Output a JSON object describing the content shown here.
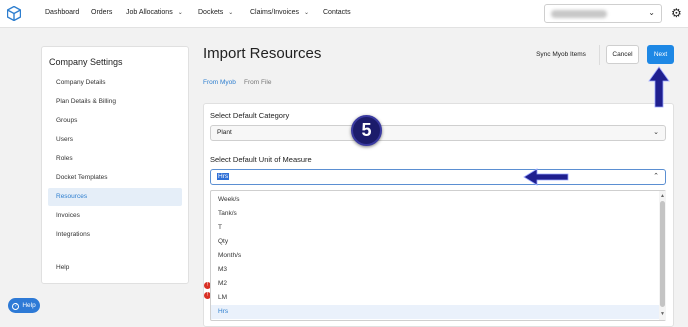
{
  "topbar": {
    "nav": [
      {
        "label": "Dashboard",
        "has_dropdown": false
      },
      {
        "label": "Orders",
        "has_dropdown": false
      },
      {
        "label": "Job Allocations",
        "has_dropdown": true
      },
      {
        "label": "Dockets",
        "has_dropdown": true
      },
      {
        "label": "Claims/Invoices",
        "has_dropdown": true
      },
      {
        "label": "Contacts",
        "has_dropdown": false
      }
    ],
    "user_select_icon": "chevron-down-icon",
    "settings_icon": "gear-icon"
  },
  "sidebar": {
    "title": "Company Settings",
    "items": [
      {
        "label": "Company Details"
      },
      {
        "label": "Plan Details & Billing"
      },
      {
        "label": "Groups"
      },
      {
        "label": "Users"
      },
      {
        "label": "Roles"
      },
      {
        "label": "Docket Templates"
      },
      {
        "label": "Resources",
        "active": true
      },
      {
        "label": "Invoices"
      },
      {
        "label": "Integrations"
      },
      {
        "label": "Help"
      }
    ]
  },
  "main": {
    "title": "Import Resources",
    "sync_label": "Sync Myob Items",
    "cancel_label": "Cancel",
    "next_label": "Next",
    "tabs": [
      {
        "label": "From Myob",
        "active": true
      },
      {
        "label": "From File",
        "active": false
      }
    ],
    "category_label": "Select Default Category",
    "category_value": "Plant",
    "uom_label": "Select Default Unit of Measure",
    "uom_value": "Hrs",
    "uom_options": [
      {
        "label": "Week/s"
      },
      {
        "label": "Tank/s"
      },
      {
        "label": "T"
      },
      {
        "label": "Qty"
      },
      {
        "label": "Month/s"
      },
      {
        "label": "M3"
      },
      {
        "label": "M2"
      },
      {
        "label": "LM"
      },
      {
        "label": "Hrs",
        "selected": true
      }
    ]
  },
  "annotation": {
    "step_number": "5",
    "badge_color": "#1c1c6b",
    "arrow_color": "#1f1f8f"
  },
  "help": {
    "label": "Help"
  },
  "colors": {
    "accent": "#1e88e5",
    "active_text": "#2d7ecf",
    "error": "#d93025"
  }
}
